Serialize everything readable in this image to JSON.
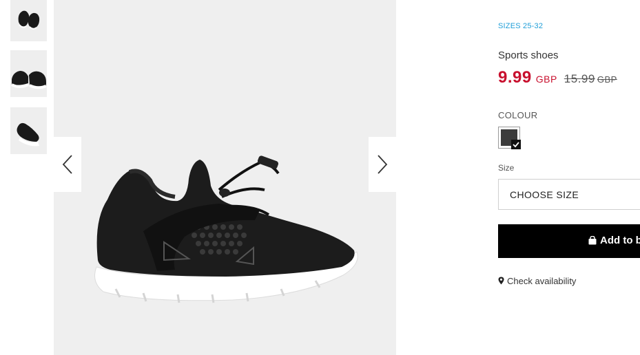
{
  "gallery": {
    "thumbnails": [
      "thumbnail-1",
      "thumbnail-2",
      "thumbnail-3"
    ],
    "prev_icon": "chevron-left-icon",
    "next_icon": "chevron-right-icon"
  },
  "product": {
    "sizes_link": "SIZES 25-32",
    "name": "Sports shoes",
    "price": "9.99",
    "price_currency": "GBP",
    "old_price": "15.99",
    "old_price_currency": "GBP",
    "price_color": "#c8102e"
  },
  "colour": {
    "label": "COLOUR",
    "swatch_color": "#3b3b3b",
    "selected": true
  },
  "size": {
    "label": "Size",
    "select_value": "CHOOSE SIZE"
  },
  "actions": {
    "add_to_bag": "Add to bag",
    "add_icon": "shopping-bag-icon",
    "check_availability": "Check availability",
    "check_icon": "map-pin-icon"
  }
}
